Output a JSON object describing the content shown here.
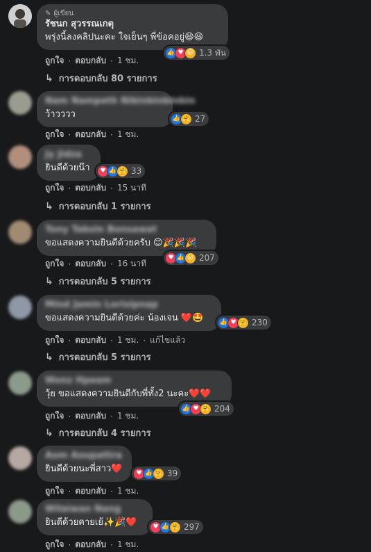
{
  "comments": [
    {
      "author_badge": "ผู้เขียน",
      "name": "รัชนก สุวรรณเกตุ",
      "text": "พรุ่งนี้ลงคลิปนะคะ ใจเย็นๆ พี่ข้อคอยู่😆😆",
      "reaction_count": "1.3 พัน",
      "like": "ถูกใจ",
      "reply": "ตอบกลับ",
      "time": "1 ชม.",
      "edited": "",
      "replies": "การตอบกลับ 80 รายการ"
    },
    {
      "name": "Nam Nampeth Nibinbinbinbin",
      "text": "ว้าวววว",
      "reaction_count": "27",
      "like": "ถูกใจ",
      "reply": "ตอบกลับ",
      "time": "1 ชม.",
      "edited": "",
      "replies": ""
    },
    {
      "name": "Jy Jidza",
      "text": "ยินดีด้วยน๊า",
      "reaction_count": "33",
      "like": "ถูกใจ",
      "reply": "ตอบกลับ",
      "time": "15 นาที",
      "edited": "",
      "replies": "การตอบกลับ 1 รายการ"
    },
    {
      "name": "Tony Tabsin Bonsawat",
      "text": "ขอแสดงความยินดีด้วยครับ 😊🎉🎉🎉",
      "reaction_count": "207",
      "like": "ถูกใจ",
      "reply": "ตอบกลับ",
      "time": "16 นาที",
      "edited": "",
      "replies": "การตอบกลับ 5 รายการ"
    },
    {
      "name": "Mind Jamin Lorisipnap",
      "text": "ขอแสดงความยินดีด้วยค่ะ น้องเจน ❤️🤩",
      "reaction_count": "230",
      "like": "ถูกใจ",
      "reply": "ตอบกลับ",
      "time": "1 ชม.",
      "edited": "แก้ไขแล้ว",
      "replies": "การตอบกลับ 5 รายการ"
    },
    {
      "name": "Wonz Hpeam",
      "text": "วุ้ย ขอแสดงความยินดีกับพี่ทั้ง2 นะคะ❤️❤️",
      "reaction_count": "204",
      "like": "ถูกใจ",
      "reply": "ตอบกลับ",
      "time": "1 ชม.",
      "edited": "",
      "replies": "การตอบกลับ 4 รายการ"
    },
    {
      "name": "Aom Aoupattra",
      "text": "ยินดีด้วยนะพี่สาว❤️",
      "reaction_count": "39",
      "like": "ถูกใจ",
      "reply": "ตอบกลับ",
      "time": "1 ชม.",
      "edited": "",
      "replies": ""
    },
    {
      "name": "Wilaiwan Nang",
      "text": "ยินดีด้วยคายเย้✨🎉❤️",
      "reaction_count": "297",
      "like": "ถูกใจ",
      "reply": "ตอบกลับ",
      "time": "1 ชม.",
      "edited": "",
      "replies": ""
    }
  ],
  "icons": {
    "like": "thumbs-up-icon",
    "love": "heart-icon",
    "care": "care-icon",
    "haha": "haha-icon",
    "wow": "wow-icon",
    "reply_arrow": "reply-arrow-icon",
    "pencil": "pencil-icon"
  },
  "colors": {
    "background": "#18191a",
    "bubble": "#3a3b3c",
    "like": "#1877f2",
    "love": "#f33e58",
    "secondary_text": "#b0b3b8"
  }
}
